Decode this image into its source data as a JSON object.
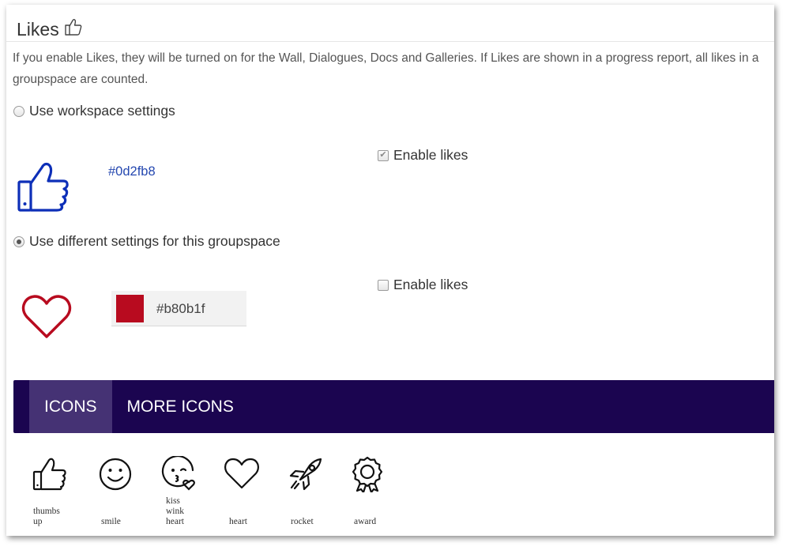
{
  "section": {
    "title": "Likes",
    "description": "If you enable Likes, they will be turned on for the Wall, Dialogues, Docs and Galleries. If Likes are shown in a progress report, all likes in a groupspace are counted."
  },
  "workspace_option": {
    "label": "Use workspace settings",
    "selected": false,
    "color_hex": "#0d2fb8",
    "enable_label": "Enable likes",
    "enable_checked": true,
    "icon": "thumbs-up-icon"
  },
  "groupspace_option": {
    "label": "Use different settings for this groupspace",
    "selected": true,
    "color_value": "#b80b1f",
    "enable_label": "Enable likes",
    "enable_checked": false,
    "icon": "heart-icon"
  },
  "tabs": [
    {
      "label": "ICONS",
      "active": true
    },
    {
      "label": "MORE ICONS",
      "active": false
    }
  ],
  "icons": [
    {
      "name": "thumbs-up-icon",
      "label": "thumbs\nup"
    },
    {
      "name": "smile-icon",
      "label": "smile"
    },
    {
      "name": "kiss-wink-heart-icon",
      "label": "kiss\nwink\nheart"
    },
    {
      "name": "heart-icon",
      "label": "heart"
    },
    {
      "name": "rocket-icon",
      "label": "rocket"
    },
    {
      "name": "award-icon",
      "label": "award"
    }
  ],
  "colors": {
    "accent_blue": "#0d2fb8",
    "accent_red": "#b80b1f",
    "tabbar_bg": "#1b0550",
    "tab_active_bg": "#453274"
  }
}
